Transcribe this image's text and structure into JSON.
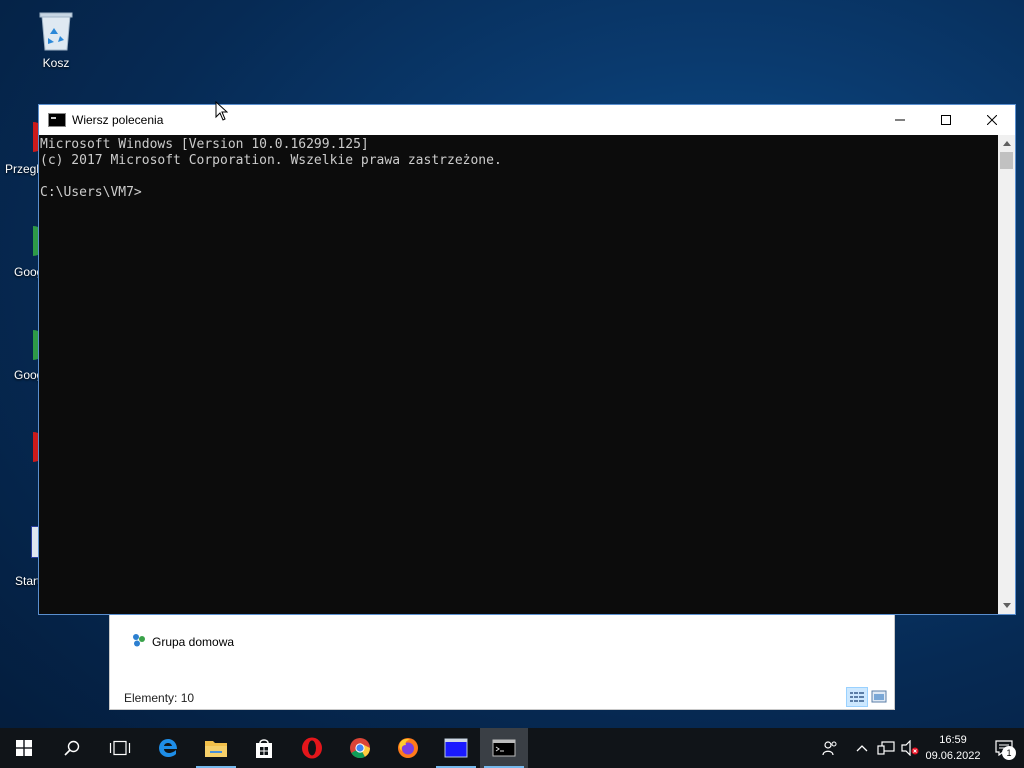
{
  "desktop": {
    "recycle_bin_label": "Kosz",
    "partial_labels": [
      "Przegl",
      "Goog",
      "Goog",
      "Start"
    ]
  },
  "explorer": {
    "nav_item_label": "Grupa domowa",
    "status_text": "Elementy: 10"
  },
  "cmd": {
    "title": "Wiersz polecenia",
    "console_lines": [
      "Microsoft Windows [Version 10.0.16299.125]",
      "(c) 2017 Microsoft Corporation. Wszelkie prawa zastrzeżone.",
      "",
      "C:\\Users\\VM7>"
    ]
  },
  "taskbar": {
    "apps": [
      "Start",
      "Search",
      "Task View",
      "Microsoft Edge",
      "File Explorer",
      "Microsoft Store",
      "Opera",
      "Google Chrome",
      "Firefox",
      "Window",
      "Wiersz polecenia"
    ],
    "clock_time": "16:59",
    "clock_date": "09.06.2022",
    "notification_count": "1"
  },
  "colors": {
    "accent": "#0078d7",
    "console_bg": "#0c0c0c",
    "console_text": "#cccccc",
    "taskbar_bg": "#101418"
  }
}
